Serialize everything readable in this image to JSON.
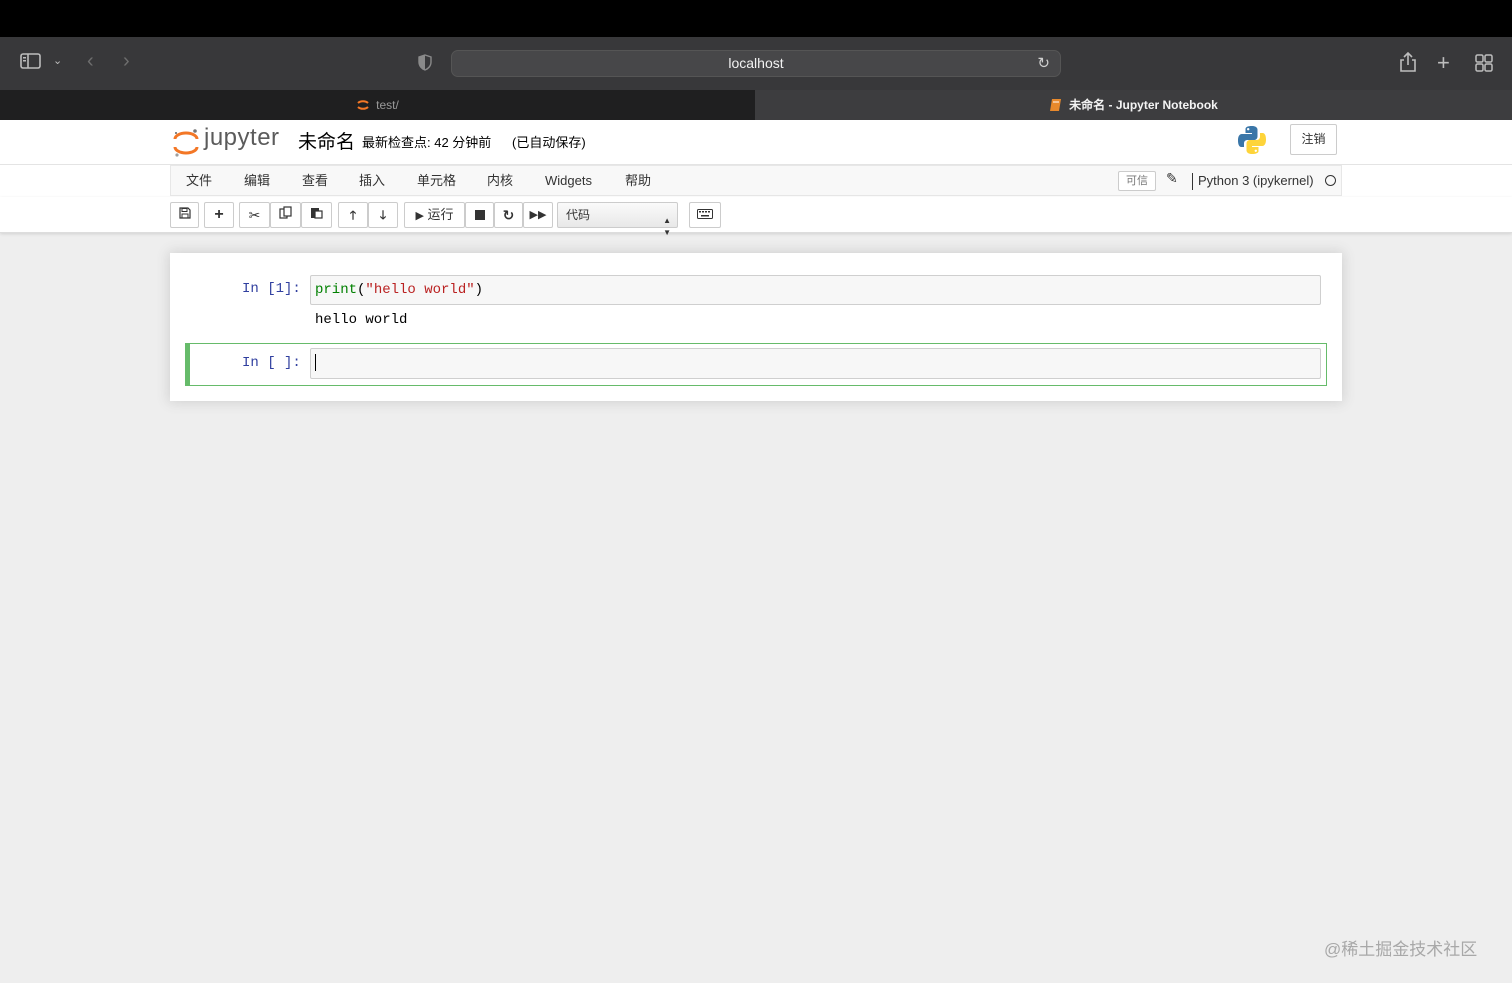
{
  "browser": {
    "url": "localhost",
    "tabs": [
      {
        "label": "test/"
      },
      {
        "label": "未命名 - Jupyter Notebook"
      }
    ]
  },
  "header": {
    "logo_text": "jupyter",
    "notebook_name": "未命名",
    "checkpoint": "最新检查点: 42 分钟前",
    "autosave": "(已自动保存)",
    "logout": "注销"
  },
  "menu": {
    "items": [
      "文件",
      "编辑",
      "查看",
      "插入",
      "单元格",
      "内核",
      "Widgets",
      "帮助"
    ],
    "trusted": "可信",
    "kernel": "Python 3 (ipykernel)"
  },
  "toolbar": {
    "run_label": "运行",
    "cell_type": "代码"
  },
  "cells": [
    {
      "prompt": "In [1]:",
      "code_fn": "print",
      "code_open": "(",
      "code_str": "\"hello world\"",
      "code_close": ")",
      "output": "hello world"
    },
    {
      "prompt": "In [ ]:"
    }
  ],
  "watermark": "@稀土掘金技术社区"
}
